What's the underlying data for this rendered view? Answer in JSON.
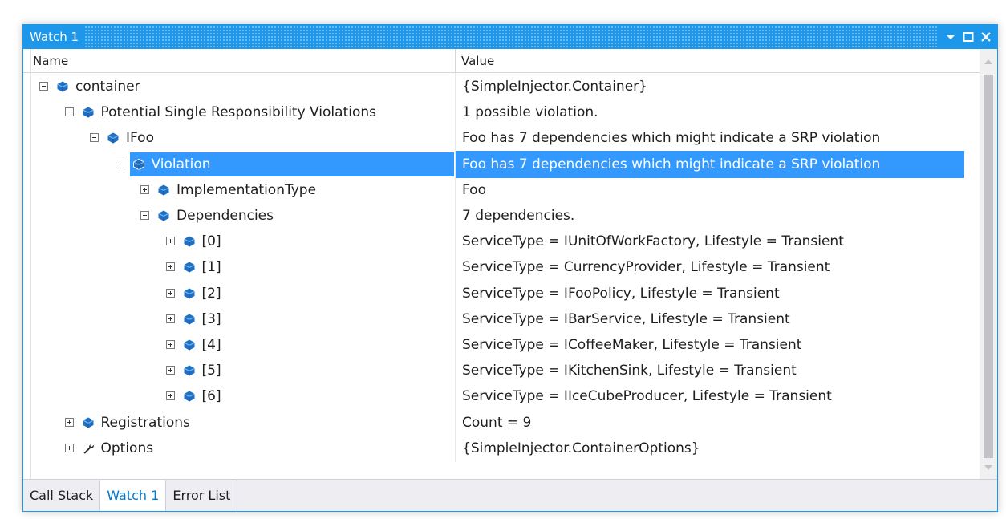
{
  "window": {
    "title": "Watch 1",
    "accent_color": "#1c97ea",
    "selection_color": "#3399ff",
    "controls": [
      "dropdown-arrow-icon",
      "maximize-icon",
      "close-icon"
    ]
  },
  "columns": {
    "name": "Name",
    "value": "Value"
  },
  "rows": [
    {
      "name": "container",
      "value": "{SimpleInjector.Container}",
      "depth": 0,
      "expander": "minus",
      "icon": "object-icon"
    },
    {
      "name": "Potential Single Responsibility Violations",
      "value": "1 possible violation.",
      "depth": 1,
      "expander": "minus",
      "icon": "object-icon"
    },
    {
      "name": "IFoo",
      "value": "Foo has 7 dependencies which might indicate a SRP violation",
      "depth": 2,
      "expander": "minus",
      "icon": "object-icon"
    },
    {
      "name": "Violation",
      "value": "Foo has 7 dependencies which might indicate a SRP violation",
      "depth": 3,
      "expander": "minus",
      "icon": "object-icon",
      "selected": true
    },
    {
      "name": "ImplementationType",
      "value": "Foo",
      "depth": 4,
      "expander": "plus",
      "icon": "object-icon"
    },
    {
      "name": "Dependencies",
      "value": "7 dependencies.",
      "depth": 4,
      "expander": "minus",
      "icon": "object-icon"
    },
    {
      "name": "[0]",
      "value": "ServiceType = IUnitOfWorkFactory, Lifestyle = Transient",
      "depth": 5,
      "expander": "plus",
      "icon": "object-icon"
    },
    {
      "name": "[1]",
      "value": "ServiceType = CurrencyProvider, Lifestyle = Transient",
      "depth": 5,
      "expander": "plus",
      "icon": "object-icon"
    },
    {
      "name": "[2]",
      "value": "ServiceType = IFooPolicy, Lifestyle = Transient",
      "depth": 5,
      "expander": "plus",
      "icon": "object-icon"
    },
    {
      "name": "[3]",
      "value": "ServiceType = IBarService, Lifestyle = Transient",
      "depth": 5,
      "expander": "plus",
      "icon": "object-icon"
    },
    {
      "name": "[4]",
      "value": "ServiceType = ICoffeeMaker, Lifestyle = Transient",
      "depth": 5,
      "expander": "plus",
      "icon": "object-icon"
    },
    {
      "name": "[5]",
      "value": "ServiceType = IKitchenSink, Lifestyle = Transient",
      "depth": 5,
      "expander": "plus",
      "icon": "object-icon"
    },
    {
      "name": "[6]",
      "value": "ServiceType = IIceCubeProducer, Lifestyle = Transient",
      "depth": 5,
      "expander": "plus",
      "icon": "object-icon"
    },
    {
      "name": "Registrations",
      "value": "Count = 9",
      "depth": 1,
      "expander": "plus",
      "icon": "object-icon"
    },
    {
      "name": "Options",
      "value": "{SimpleInjector.ContainerOptions}",
      "depth": 1,
      "expander": "plus",
      "icon": "wrench-icon"
    }
  ],
  "tabs": [
    {
      "label": "Call Stack",
      "active": false
    },
    {
      "label": "Watch 1",
      "active": true
    },
    {
      "label": "Error List",
      "active": false
    }
  ]
}
